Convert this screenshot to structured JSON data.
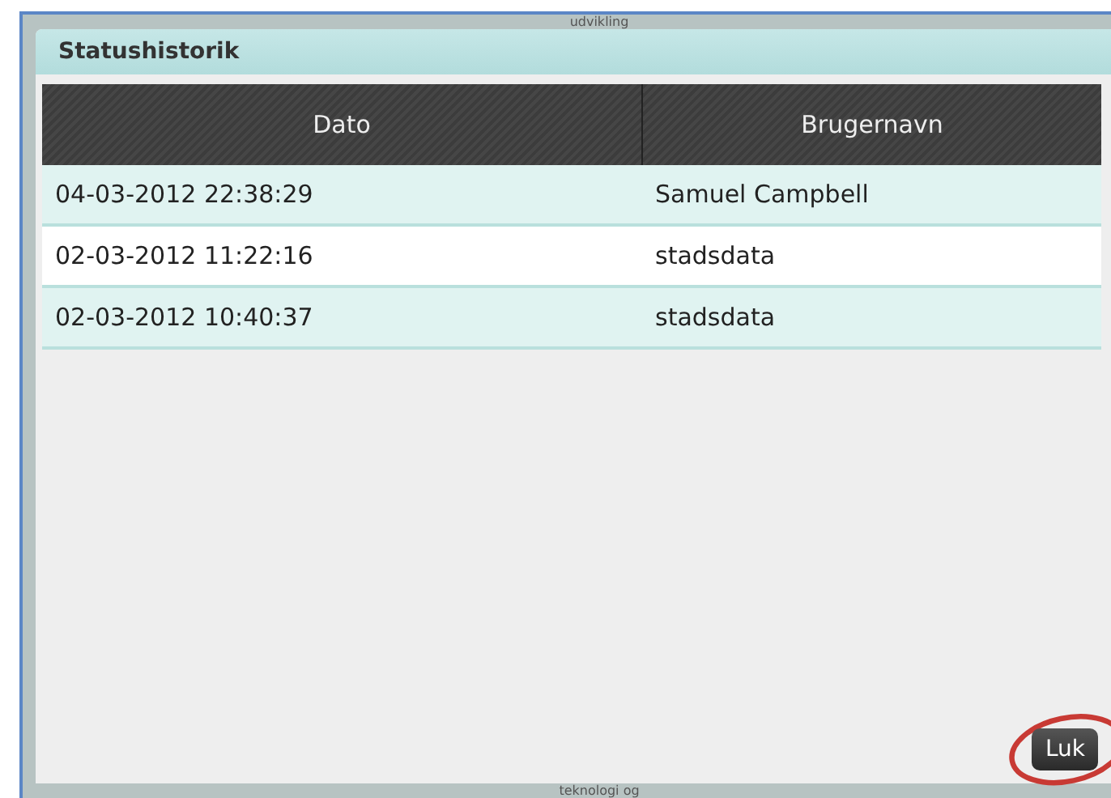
{
  "background": {
    "top_text": "udvikling",
    "bottom_text": "teknologi og"
  },
  "dialog": {
    "title": "Statushistorik",
    "table": {
      "columns": [
        "Dato",
        "Brugernavn"
      ],
      "rows": [
        {
          "cells": [
            "04-03-2012 22:38:29",
            "Samuel Campbell"
          ]
        },
        {
          "cells": [
            "02-03-2012 11:22:16",
            "stadsdata"
          ]
        },
        {
          "cells": [
            "02-03-2012 10:40:37",
            "stadsdata"
          ]
        }
      ]
    },
    "close_button": {
      "label": "Luk",
      "highlighted": true
    }
  }
}
